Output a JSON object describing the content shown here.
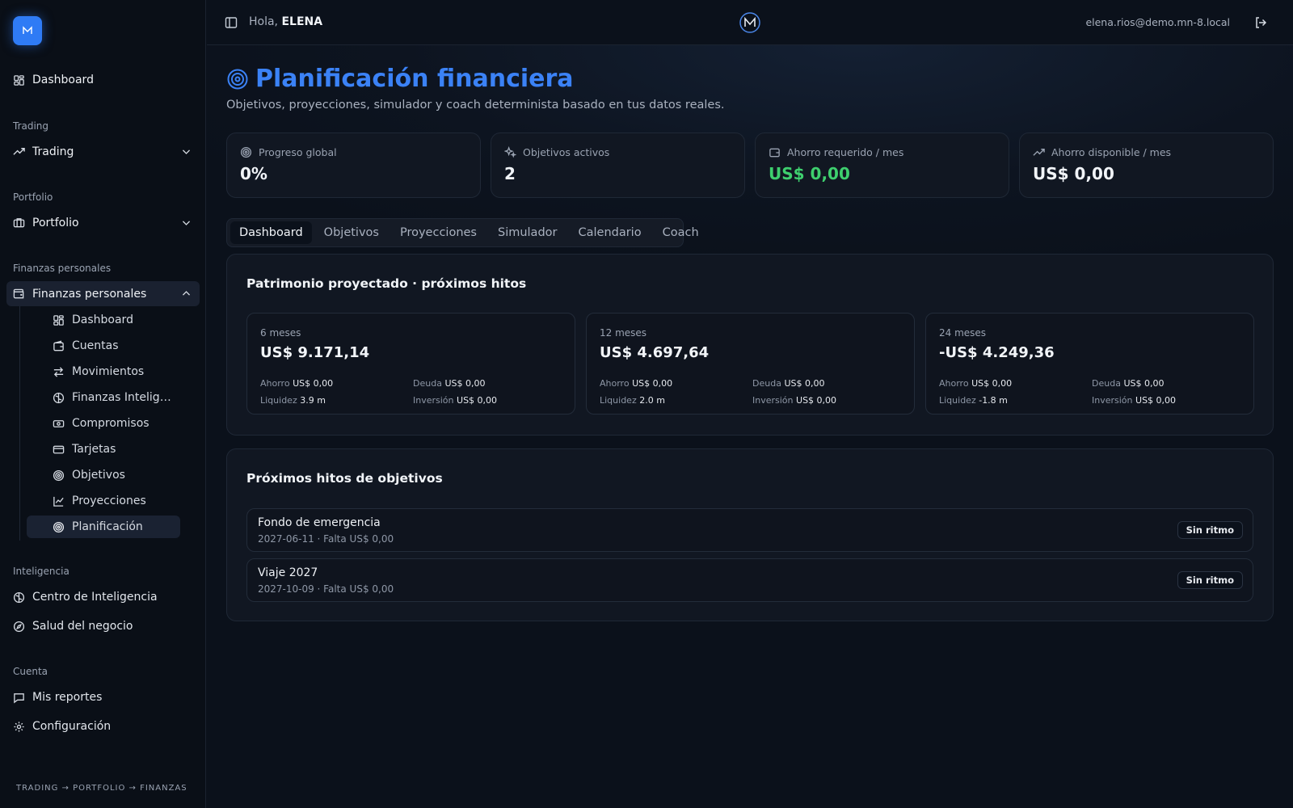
{
  "sidebar": {
    "dashboard": "Dashboard",
    "trading_section": "Trading",
    "trading_group": "Trading",
    "portfolio_section": "Portfolio",
    "portfolio_group": "Portfolio",
    "finanzas_section": "Finanzas personales",
    "finanzas_group": "Finanzas personales",
    "finanzas_items": [
      "Dashboard",
      "Cuentas",
      "Movimientos",
      "Finanzas Inteligentes",
      "Compromisos",
      "Tarjetas",
      "Objetivos",
      "Proyecciones",
      "Planificación"
    ],
    "inteligencia_section": "Inteligencia",
    "inteligencia_items": [
      "Centro de Inteligencia",
      "Salud del negocio"
    ],
    "cuenta_section": "Cuenta",
    "cuenta_items": [
      "Mis reportes",
      "Configuración"
    ],
    "breadcrumb": "TRADING → PORTFOLIO → FINANZAS"
  },
  "topbar": {
    "greeting": "Hola,",
    "user": "ELENA",
    "email": "elena.rios@demo.mn-8.local"
  },
  "page": {
    "title": "Planificación financiera",
    "subtitle": "Objetivos, proyecciones, simulador y coach determinista basado en tus datos reales."
  },
  "stats": [
    {
      "label": "Progreso global",
      "value": "0%",
      "icon": "target-icon"
    },
    {
      "label": "Objetivos activos",
      "value": "2",
      "icon": "sparkles-icon"
    },
    {
      "label": "Ahorro requerido / mes",
      "value": "US$ 0,00",
      "icon": "wallet-icon",
      "color": "#3ecf6e"
    },
    {
      "label": "Ahorro disponible / mes",
      "value": "US$ 0,00",
      "icon": "trending-up-icon"
    }
  ],
  "tabs": [
    "Dashboard",
    "Objetivos",
    "Proyecciones",
    "Simulador",
    "Calendario",
    "Coach"
  ],
  "projection": {
    "title": "Patrimonio proyectado · próximos hitos",
    "labels": {
      "ahorro": "Ahorro",
      "deuda": "Deuda",
      "liquidez": "Liquidez",
      "inversion": "Inversión"
    },
    "cards": [
      {
        "period": "6 meses",
        "value": "US$ 9.171,14",
        "ahorro": "US$ 0,00",
        "deuda": "US$ 0,00",
        "liquidez": "3.9 m",
        "inversion": "US$ 0,00"
      },
      {
        "period": "12 meses",
        "value": "US$ 4.697,64",
        "ahorro": "US$ 0,00",
        "deuda": "US$ 0,00",
        "liquidez": "2.0 m",
        "inversion": "US$ 0,00"
      },
      {
        "period": "24 meses",
        "value": "-US$ 4.249,36",
        "ahorro": "US$ 0,00",
        "deuda": "US$ 0,00",
        "liquidez": "-1.8 m",
        "inversion": "US$ 0,00"
      }
    ]
  },
  "milestones": {
    "title": "Próximos hitos de objetivos",
    "items": [
      {
        "name": "Fondo de emergencia",
        "detail": "2027-06-11 · Falta US$ 0,00",
        "badge": "Sin ritmo"
      },
      {
        "name": "Viaje 2027",
        "detail": "2027-10-09 · Falta US$ 0,00",
        "badge": "Sin ritmo"
      }
    ]
  },
  "colors": {
    "accent": "#3b82f6",
    "positive": "#3ecf6e",
    "background": "#0b111b"
  }
}
